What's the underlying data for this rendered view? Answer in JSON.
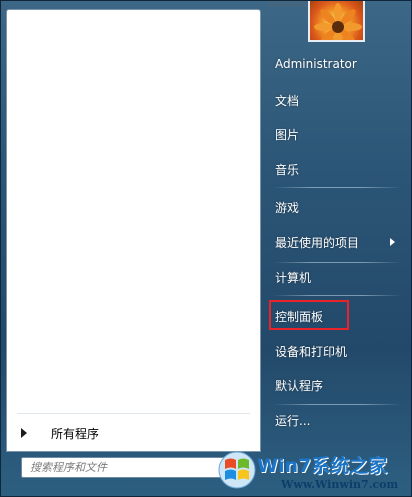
{
  "user": {
    "name": "Administrator"
  },
  "left_pane": {
    "all_programs_label": "所有程序",
    "search_placeholder": "搜索程序和文件"
  },
  "right_menu": {
    "items": [
      {
        "label": "Administrator"
      },
      {
        "label": "文档"
      },
      {
        "label": "图片"
      },
      {
        "label": "音乐"
      },
      {
        "label": "游戏"
      },
      {
        "label": "最近使用的项目"
      },
      {
        "label": "计算机"
      },
      {
        "label": "控制面板"
      },
      {
        "label": "设备和打印机"
      },
      {
        "label": "默认程序"
      },
      {
        "label": "运行..."
      }
    ]
  },
  "highlight": {
    "color": "#e8242a",
    "target": "控制面板"
  },
  "watermark": {
    "title": "Win7系统之家",
    "url": "Www.Winwin7.com"
  }
}
